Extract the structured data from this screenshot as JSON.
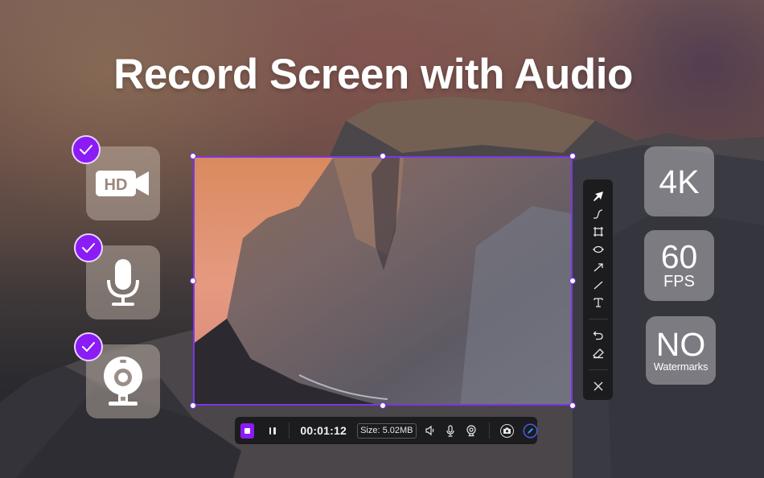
{
  "headline": "Record Screen with Audio",
  "features": [
    {
      "name": "hd-video",
      "icon": "hd-camera-icon",
      "label": "HD",
      "checked": true
    },
    {
      "name": "microphone",
      "icon": "microphone-icon",
      "checked": true
    },
    {
      "name": "webcam",
      "icon": "webcam-icon",
      "checked": true
    }
  ],
  "badges": [
    {
      "big": "4K",
      "small": ""
    },
    {
      "big": "60",
      "small": "FPS"
    },
    {
      "big": "NO",
      "small": "Watermarks"
    }
  ],
  "annotation_tools": [
    {
      "name": "select",
      "icon": "cursor-arrow-icon"
    },
    {
      "name": "freehand",
      "icon": "freehand-curve-icon"
    },
    {
      "name": "rectangle",
      "icon": "rectangle-icon"
    },
    {
      "name": "ellipse",
      "icon": "ellipse-icon"
    },
    {
      "name": "arrow",
      "icon": "arrow-icon"
    },
    {
      "name": "line",
      "icon": "line-icon"
    },
    {
      "name": "text",
      "icon": "text-icon"
    },
    {
      "name": "undo",
      "icon": "undo-icon"
    },
    {
      "name": "eraser",
      "icon": "eraser-icon"
    },
    {
      "name": "close",
      "icon": "close-icon"
    }
  ],
  "recording_bar": {
    "timer": "00:01:12",
    "size_label": "Size: 5.02MB",
    "controls": [
      "stop-icon",
      "pause-icon",
      "speaker-icon",
      "microphone-icon",
      "webcam-icon",
      "camera-icon",
      "pen-icon"
    ]
  },
  "colors": {
    "accent": "#8b1cf5",
    "frame": "#7b35e8",
    "toolbar_bg": "#1c1c1e",
    "pen_ring": "#3a6cff"
  }
}
